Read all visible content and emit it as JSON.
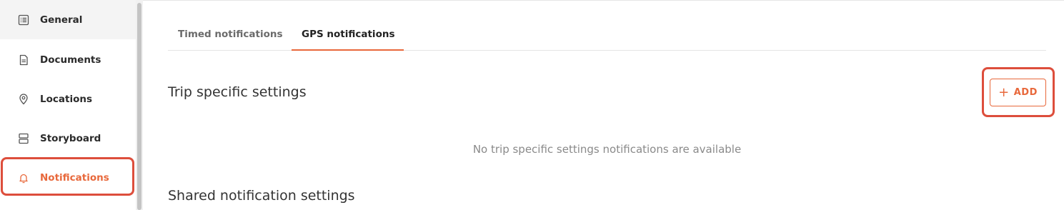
{
  "sidebar": {
    "items": [
      {
        "label": "General",
        "icon": "list-icon"
      },
      {
        "label": "Documents",
        "icon": "document-icon"
      },
      {
        "label": "Locations",
        "icon": "location-pin-icon"
      },
      {
        "label": "Storyboard",
        "icon": "storyboard-icon"
      },
      {
        "label": "Notifications",
        "icon": "bell-icon",
        "active": true
      }
    ]
  },
  "tabs": [
    {
      "label": "Timed notifications"
    },
    {
      "label": "GPS notifications",
      "active": true
    }
  ],
  "trip_section": {
    "title": "Trip specific settings",
    "add_label": "ADD",
    "empty_message": "No trip specific settings notifications are available"
  },
  "shared_section": {
    "title": "Shared notification settings"
  },
  "colors": {
    "accent": "#e8683b",
    "highlight": "#dd4e3c"
  }
}
